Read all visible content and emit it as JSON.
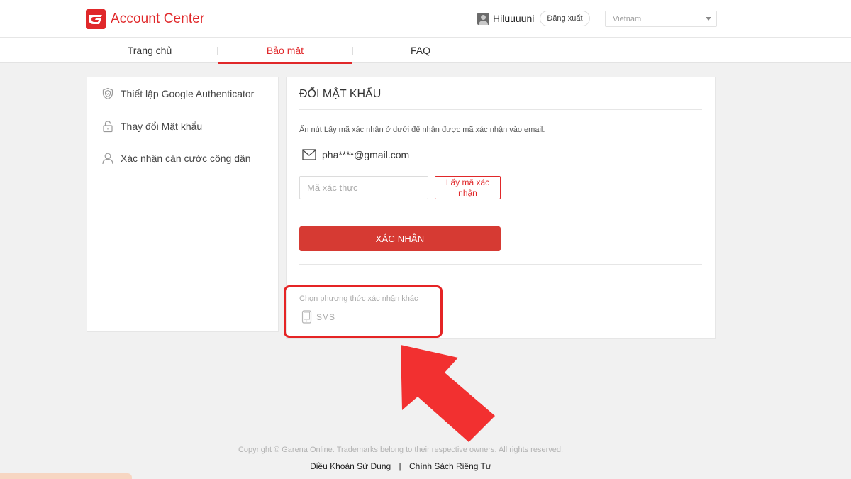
{
  "header": {
    "brand": "Account Center",
    "username": "Hiluuuuni",
    "logout_label": "Đăng xuất",
    "language_selected": "Vietnam"
  },
  "nav": {
    "tabs": [
      {
        "label": "Trang chủ",
        "active": false
      },
      {
        "label": "Bảo mật",
        "active": true
      },
      {
        "label": "FAQ",
        "active": false
      }
    ]
  },
  "sidebar": {
    "items": [
      {
        "label": "Thiết lập Google Authenticator",
        "icon": "shield-icon"
      },
      {
        "label": "Thay đổi Mật khẩu",
        "icon": "lock-icon"
      },
      {
        "label": "Xác nhận căn cước công dân",
        "icon": "user-icon"
      }
    ]
  },
  "main": {
    "title": "ĐỔI MẬT KHẨU",
    "hint": "Ấn nút Lấy mã xác nhận ở dưới để nhận được mã xác nhận vào email.",
    "email": "pha****@gmail.com",
    "code_placeholder": "Mã xác thực",
    "get_code_label": "Lấy mã xác nhận",
    "confirm_label": "XÁC NHẬN",
    "alt_method_label": "Chọn phương thức xác nhận khác",
    "alt_sms_label": "SMS"
  },
  "footer": {
    "copyright": "Copyright © Garena Online. Trademarks belong to their respective owners. All rights reserved.",
    "terms": "Điều Khoản Sử Dụng",
    "separator": "|",
    "privacy": "Chính Sách Riêng Tư"
  },
  "colors": {
    "brand_red": "#e0282a",
    "confirm_red": "#d63a33",
    "highlight_red": "#e52425",
    "arrow_red": "#f23030"
  }
}
